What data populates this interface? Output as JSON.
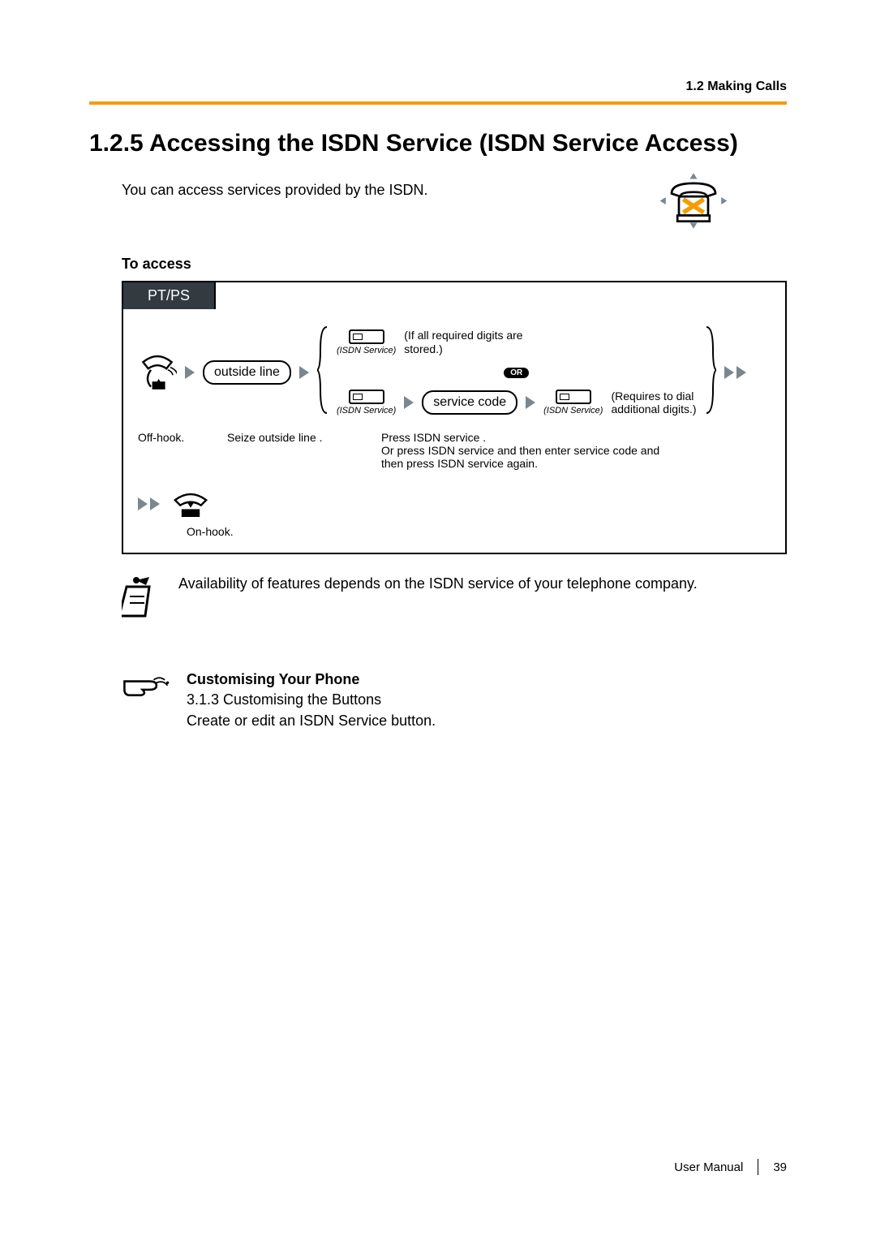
{
  "breadcrumb": "1.2 Making Calls",
  "section_title": "1.2.5   Accessing the ISDN Service (ISDN Service Access)",
  "intro": "You can access services provided by the ISDN.",
  "subhead": "To access",
  "proc": {
    "tab": "PT/PS",
    "outside_line": "outside line",
    "isdn_service_label": "(ISDN Service)",
    "or_label": "OR",
    "service_code": "service code",
    "branch_top_note": "(If all required digits are stored.)",
    "branch_bottom_note_line1": "(Requires to dial",
    "branch_bottom_note_line2": "additional digits.)",
    "step_offhook": "Off-hook.",
    "step_seize": "Seize outside line  .",
    "step_press_line1": "Press ISDN service  .",
    "step_press_line2": "Or press ISDN service  and then enter service code   and",
    "step_press_line3": "then press ISDN service  again.",
    "onhook": "On-hook."
  },
  "note_text": "Availability of features depends on the ISDN service of your telephone company.",
  "customising": {
    "title": "Customising Your Phone",
    "line1": "3.1.3 Customising the Buttons",
    "line2": "Create or edit an ISDN Service button."
  },
  "footer": {
    "manual": "User Manual",
    "page": "39"
  },
  "icons": {
    "phone_unsupported": "phone-x-icon",
    "offhook": "handset-offhook-icon",
    "onhook": "handset-onhook-icon",
    "arrow": "arrow-right-icon",
    "isdn_button": "isdn-service-button-icon",
    "brace_left": "brace-left-icon",
    "brace_right": "brace-right-icon",
    "note": "note-clipboard-icon",
    "hand": "hand-pointing-icon"
  }
}
